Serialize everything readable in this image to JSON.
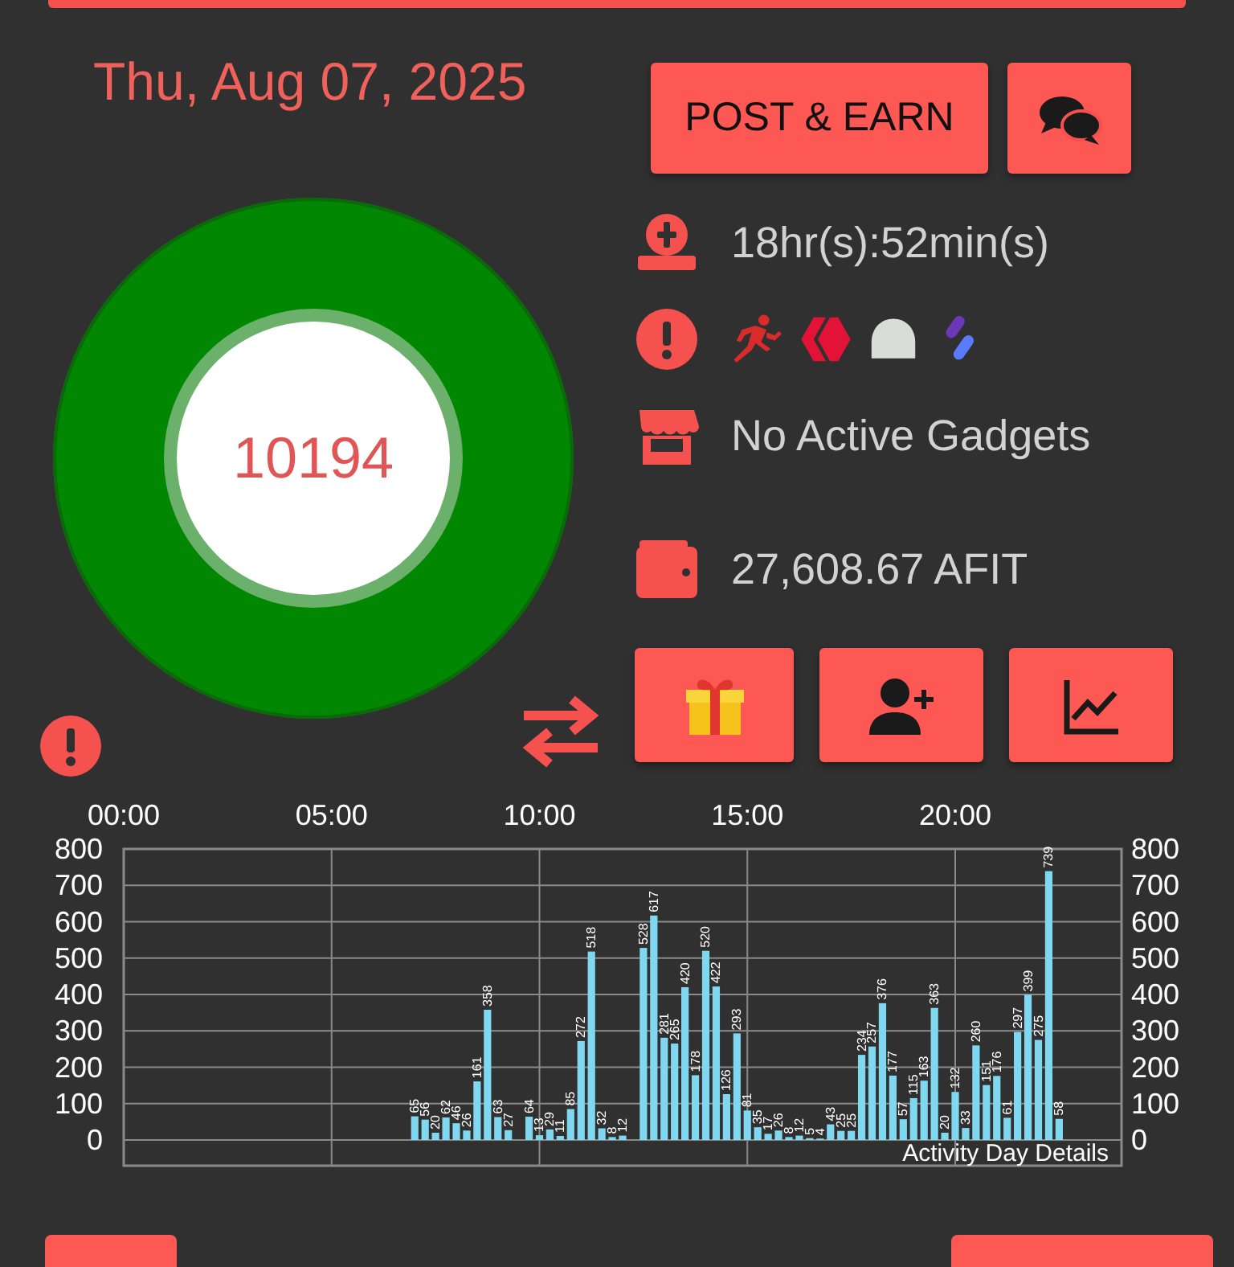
{
  "header": {
    "date": "Thu, Aug 07, 2025"
  },
  "actions": [
    {
      "kind": "text",
      "label": "POST & EARN"
    },
    {
      "kind": "chat"
    }
  ],
  "steps": {
    "count": "10194"
  },
  "info": [
    {
      "kind": "timer",
      "text": "18hr(s):52min(s)"
    },
    {
      "kind": "apps",
      "apps": [
        {
          "kind": "runner"
        },
        {
          "kind": "hive"
        },
        {
          "kind": "dome"
        },
        {
          "kind": "capsule"
        }
      ]
    },
    {
      "kind": "store",
      "text": "No Active Gadgets"
    },
    {
      "kind": "wallet",
      "text": "27,608.67 AFIT"
    }
  ],
  "tools": [
    {
      "kind": "gift"
    },
    {
      "kind": "add-user"
    },
    {
      "kind": "chart"
    }
  ],
  "activity": {
    "chart_data": {
      "type": "bar",
      "title": "Activity Day Details",
      "x": [
        7,
        7.25,
        7.5,
        7.75,
        8,
        8.25,
        8.5,
        8.75,
        9,
        9.25,
        9.75,
        10,
        10.25,
        10.5,
        10.75,
        11,
        11.25,
        11.5,
        11.75,
        12,
        12.5,
        12.75,
        13,
        13.25,
        13.5,
        13.75,
        14,
        14.25,
        14.5,
        14.75,
        15,
        15.25,
        15.5,
        15.75,
        16,
        16.25,
        16.5,
        16.75,
        17,
        17.25,
        17.5,
        17.75,
        18,
        18.25,
        18.5,
        18.75,
        19,
        19.25,
        19.5,
        19.75,
        20,
        20.25,
        20.5,
        20.75,
        21,
        21.25,
        21.5,
        21.75,
        22,
        22.25,
        22.5
      ],
      "series": [
        {
          "color": "#80d8f0",
          "values": [
            65,
            56,
            20,
            62,
            46,
            26,
            161,
            358,
            63,
            27,
            64,
            13,
            29,
            11,
            85,
            272,
            518,
            32,
            8,
            12,
            528,
            617,
            281,
            265,
            420,
            178,
            520,
            422,
            126,
            293,
            81,
            35,
            17,
            26,
            8,
            12,
            5,
            4,
            43,
            25,
            25,
            234,
            257,
            376,
            177,
            57,
            115,
            163,
            363,
            20,
            132,
            33,
            260,
            151,
            176,
            61,
            297,
            399,
            275,
            739,
            58
          ]
        }
      ],
      "xlim": [
        0,
        24
      ],
      "xticks": [
        {
          "value": 0,
          "label": "00:00"
        },
        {
          "value": 5,
          "label": "05:00"
        },
        {
          "value": 10,
          "label": "10:00"
        },
        {
          "value": 15,
          "label": "15:00"
        },
        {
          "value": 20,
          "label": "20:00"
        }
      ],
      "ylim": [
        0,
        800
      ],
      "yticks": [
        {
          "value": 0,
          "label": "0"
        },
        {
          "value": 100,
          "label": "100"
        },
        {
          "value": 200,
          "label": "200"
        },
        {
          "value": 300,
          "label": "300"
        },
        {
          "value": 400,
          "label": "400"
        },
        {
          "value": 500,
          "label": "500"
        },
        {
          "value": 600,
          "label": "600"
        },
        {
          "value": 700,
          "label": "700"
        },
        {
          "value": 800,
          "label": "800"
        }
      ],
      "y2ticks": [
        {
          "value": 0,
          "label": "0"
        },
        {
          "value": 100,
          "label": "100"
        },
        {
          "value": 200,
          "label": "200"
        },
        {
          "value": 300,
          "label": "300"
        },
        {
          "value": 400,
          "label": "400"
        },
        {
          "value": 500,
          "label": "500"
        },
        {
          "value": 600,
          "label": "600"
        },
        {
          "value": 700,
          "label": "700"
        },
        {
          "value": 800,
          "label": "800"
        }
      ],
      "y2lim": [
        0,
        800
      ],
      "grid": true,
      "data_labels": true
    }
  }
}
